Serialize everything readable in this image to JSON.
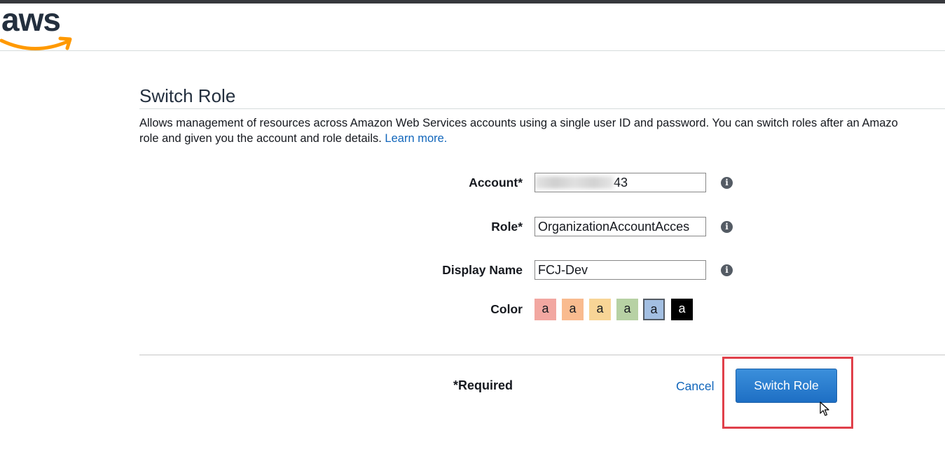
{
  "header": {
    "logo_text": "aws",
    "colors": {
      "topbar": "#37393d",
      "logo_text": "#232f3e",
      "logo_smile": "#ff9900"
    }
  },
  "page": {
    "title": "Switch Role",
    "description": "Allows management of resources across Amazon Web Services accounts using a single user ID and password. You can switch roles after an Amazo",
    "description_line2": "role and given you the account and role details.",
    "learn_more": "Learn more."
  },
  "form": {
    "account": {
      "label": "Account*",
      "value_visible_suffix": "43",
      "value_redacted": true
    },
    "role": {
      "label": "Role*",
      "value": "OrganizationAccountAcces"
    },
    "display_name": {
      "label": "Display Name",
      "value": "FCJ-Dev"
    },
    "color": {
      "label": "Color",
      "swatch_letter": "a",
      "swatches": [
        {
          "color": "#f2a7a1",
          "text_color": "#16191f",
          "selected": false
        },
        {
          "color": "#f9bb8f",
          "text_color": "#16191f",
          "selected": false
        },
        {
          "color": "#f8d596",
          "text_color": "#16191f",
          "selected": false
        },
        {
          "color": "#b7d1a4",
          "text_color": "#16191f",
          "selected": false
        },
        {
          "color": "#a3bfe2",
          "text_color": "#16191f",
          "selected": true
        },
        {
          "color": "#000000",
          "text_color": "#ffffff",
          "selected": false
        }
      ]
    }
  },
  "footer": {
    "required_note": "*Required",
    "cancel_label": "Cancel",
    "submit_label": "Switch Role"
  },
  "icons": {
    "info": "info-icon",
    "cursor": "mouse-pointer-icon"
  },
  "colors": {
    "link": "#1166bb",
    "primary_button": "#1e6fc4",
    "highlight_box": "#e0404a"
  }
}
